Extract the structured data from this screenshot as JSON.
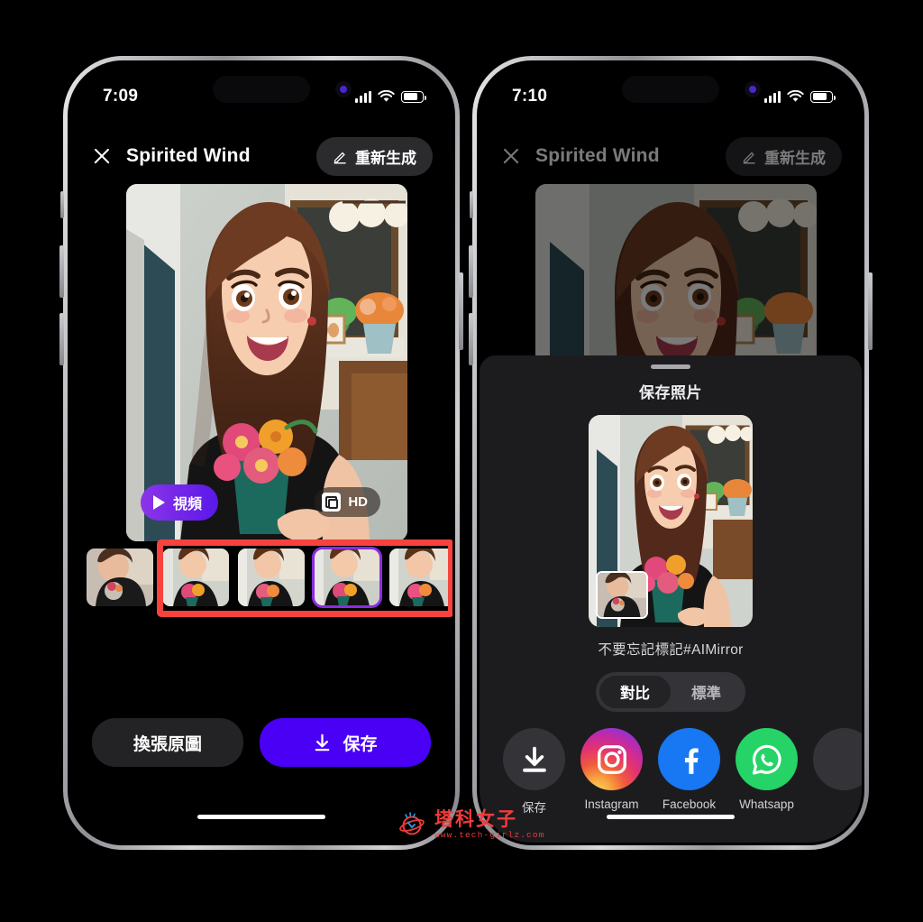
{
  "left_phone": {
    "status": {
      "time": "7:09",
      "signal_icon": "cellular-bars-icon",
      "wifi_icon": "wifi-icon",
      "battery_icon": "battery-icon"
    },
    "header": {
      "close_icon": "close-x-icon",
      "title": "Spirited Wind",
      "regenerate_label": "重新生成",
      "regenerate_icon": "pencil-icon"
    },
    "hero": {
      "video_badge_label": "視頻",
      "video_play_icon": "play-icon",
      "hd_badge_label": "HD",
      "hd_icon": "resize-frames-icon"
    },
    "thumbnails": [
      {
        "name": "original-photo",
        "selected": false,
        "styled": false
      },
      {
        "name": "variant-1",
        "selected": false,
        "styled": true
      },
      {
        "name": "variant-2",
        "selected": false,
        "styled": true
      },
      {
        "name": "variant-3",
        "selected": true,
        "styled": true
      },
      {
        "name": "variant-4",
        "selected": false,
        "styled": true
      }
    ],
    "annotation": {
      "type": "red-rectangle-highlight",
      "color": "#f8423f"
    },
    "actions": {
      "change_photo_label": "換張原圖",
      "save_label": "保存",
      "save_icon": "download-icon"
    }
  },
  "right_phone": {
    "status": {
      "time": "7:10",
      "signal_icon": "cellular-bars-icon",
      "wifi_icon": "wifi-icon",
      "battery_icon": "battery-icon"
    },
    "header": {
      "close_icon": "close-x-icon",
      "title": "Spirited Wind",
      "regenerate_label": "重新生成",
      "regenerate_icon": "pencil-icon"
    },
    "sheet": {
      "grabber_icon": "drag-handle-icon",
      "title": "保存照片",
      "hashtag_text": "不要忘記標記#AIMirror",
      "segmented": {
        "options": [
          "對比",
          "標準"
        ],
        "selected": "對比"
      },
      "share_targets": [
        {
          "label": "保存",
          "icon": "download-icon",
          "style": "dark"
        },
        {
          "label": "Instagram",
          "icon": "instagram-icon",
          "style": "ig"
        },
        {
          "label": "Facebook",
          "icon": "facebook-icon",
          "style": "fb"
        },
        {
          "label": "Whatsapp",
          "icon": "whatsapp-icon",
          "style": "wa"
        },
        {
          "label": "",
          "icon": "more-icon",
          "style": "cut"
        }
      ]
    }
  },
  "watermark": {
    "logo_icon": "tech-girlz-logo-icon",
    "name": "塔科女子",
    "url": "www.tech-girlz.com",
    "color": "#ef3b3b"
  },
  "theme": {
    "accent_purple": "#4a00f5",
    "selection_purple": "#8b2be2",
    "annotation_red": "#f8423f",
    "sheet_bg": "#1c1c1e"
  }
}
